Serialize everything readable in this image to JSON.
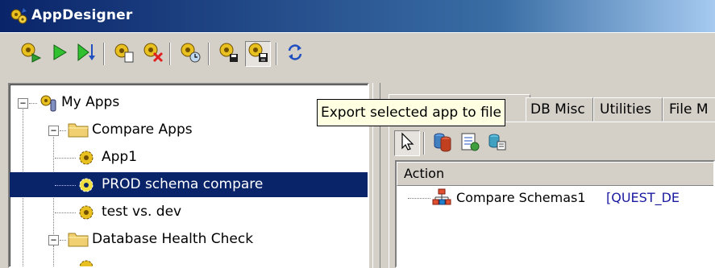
{
  "window": {
    "title": "AppDesigner",
    "icon": "gears-icon"
  },
  "toolbar": {
    "buttons": [
      {
        "name": "run-gear-button",
        "icon": "gear-run-icon"
      },
      {
        "name": "run-button",
        "icon": "play-icon"
      },
      {
        "name": "step-button",
        "icon": "step-down-icon"
      },
      {
        "name": "new-app-button",
        "icon": "gear-new-icon"
      },
      {
        "name": "delete-app-button",
        "icon": "gear-delete-icon"
      },
      {
        "name": "schedule-app-button",
        "icon": "gear-clock-icon"
      },
      {
        "name": "import-app-button",
        "icon": "gear-import-icon"
      },
      {
        "name": "export-app-button",
        "icon": "gear-export-icon"
      },
      {
        "name": "refresh-button",
        "icon": "refresh-icon"
      }
    ]
  },
  "tree": {
    "items": [
      {
        "label": "My Apps",
        "level": 0,
        "expander": "−"
      },
      {
        "label": "Compare Apps",
        "level": 1,
        "expander": "−"
      },
      {
        "label": "App1",
        "level": 2
      },
      {
        "label": "PROD schema compare",
        "level": 2,
        "selected": true
      },
      {
        "label": "test vs. dev",
        "level": 2
      },
      {
        "label": "Database Health Check",
        "level": 1,
        "expander": "−"
      }
    ]
  },
  "tabs": [
    {
      "label": "DB Misc"
    },
    {
      "label": "Utilities"
    },
    {
      "label": "File M"
    }
  ],
  "inner_toolbar": [
    {
      "name": "pointer-button",
      "icon": "cursor-arrow-icon"
    },
    {
      "name": "db-compare-button",
      "icon": "database-compare-icon"
    },
    {
      "name": "report-button",
      "icon": "report-icon"
    },
    {
      "name": "schema-button",
      "icon": "schema-icon"
    }
  ],
  "list": {
    "header": "Action",
    "rows": [
      {
        "label": "Compare Schemas1",
        "tag": "[QUEST_DE"
      }
    ]
  },
  "tooltip": {
    "text": "Export selected app to file"
  },
  "colors": {
    "title_start": "#0a246a",
    "title_end": "#a6caf0",
    "selection": "#0a246a",
    "tooltip_bg": "#ffffe1",
    "tag_text": "#1a1aa0"
  }
}
